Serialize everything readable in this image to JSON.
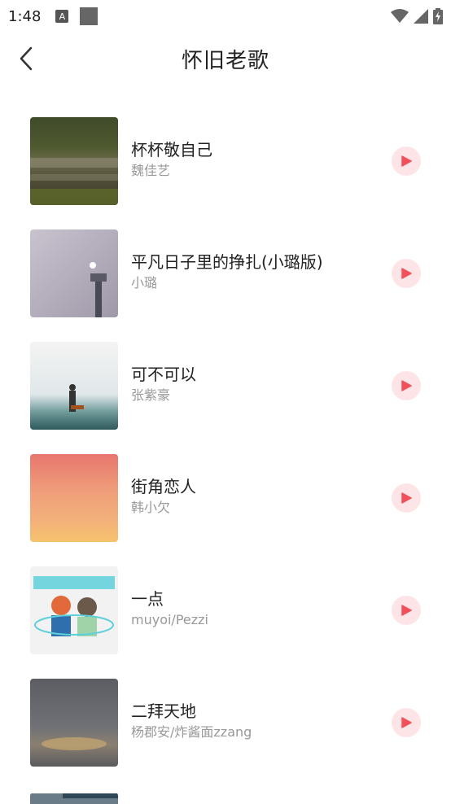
{
  "status": {
    "time": "1:48",
    "badge": "A"
  },
  "header": {
    "title": "怀旧老歌"
  },
  "songs": [
    {
      "title": "杯杯敬自己",
      "artist": "魏佳艺"
    },
    {
      "title": "平凡日子里的挣扎(小璐版)",
      "artist": "小璐"
    },
    {
      "title": "可不可以",
      "artist": "张紫豪"
    },
    {
      "title": "街角恋人",
      "artist": "韩小欠"
    },
    {
      "title": "一点",
      "artist": "muyoi/Pezzi"
    },
    {
      "title": "二拜天地",
      "artist": "杨郡安/炸酱面zzang"
    }
  ],
  "colors": {
    "play_bg": "#fde4e6",
    "play_icon": "#f0505a"
  },
  "icons": {
    "back": "chevron-left-icon",
    "play": "play-icon"
  }
}
